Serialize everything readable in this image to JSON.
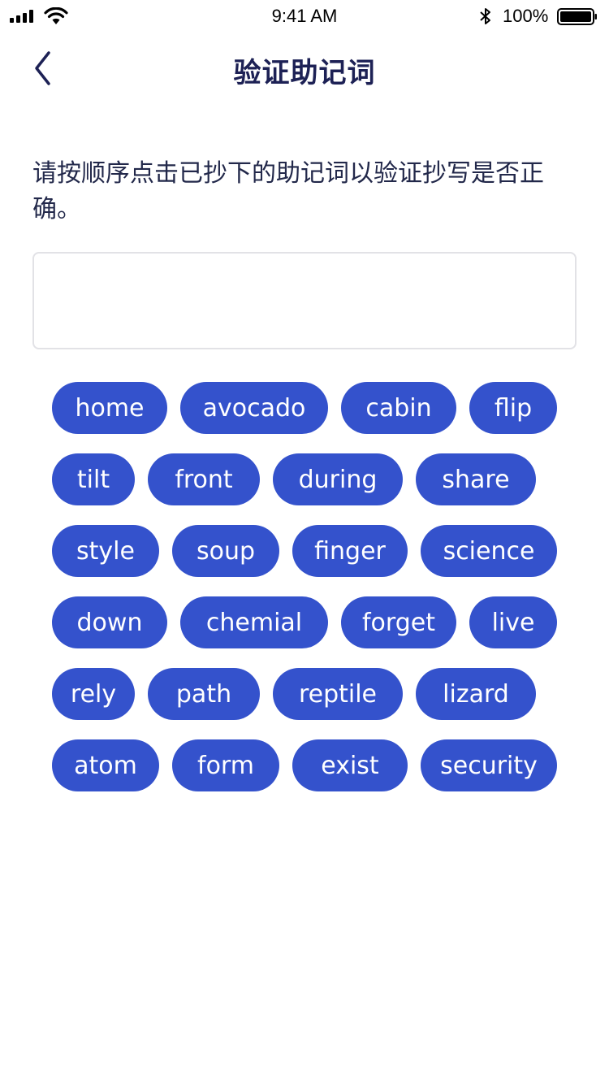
{
  "status_bar": {
    "time": "9:41 AM",
    "battery": "100%",
    "icons": [
      "signal-icon",
      "wifi-icon",
      "bluetooth-icon",
      "battery-icon"
    ]
  },
  "header": {
    "title": "验证助记词",
    "back_icon": "chevron-left-icon"
  },
  "instruction": "请按顺序点击已抄下的助记词以验证抄写是否正确。",
  "selected_words": [],
  "word_options": [
    [
      "home",
      "avocado",
      "cabin",
      "flip"
    ],
    [
      "tilt",
      "front",
      "during",
      "share"
    ],
    [
      "style",
      "soup",
      "finger",
      "science"
    ],
    [
      "down",
      "chemial",
      "forget",
      "live"
    ],
    [
      "rely",
      "path",
      "reptile",
      "lizard"
    ],
    [
      "atom",
      "form",
      "exist",
      "security"
    ]
  ],
  "colors": {
    "chip_background": "#3452cc",
    "chip_text": "#ffffff",
    "title_text": "#1d2155",
    "box_border": "#e2e2e6"
  }
}
